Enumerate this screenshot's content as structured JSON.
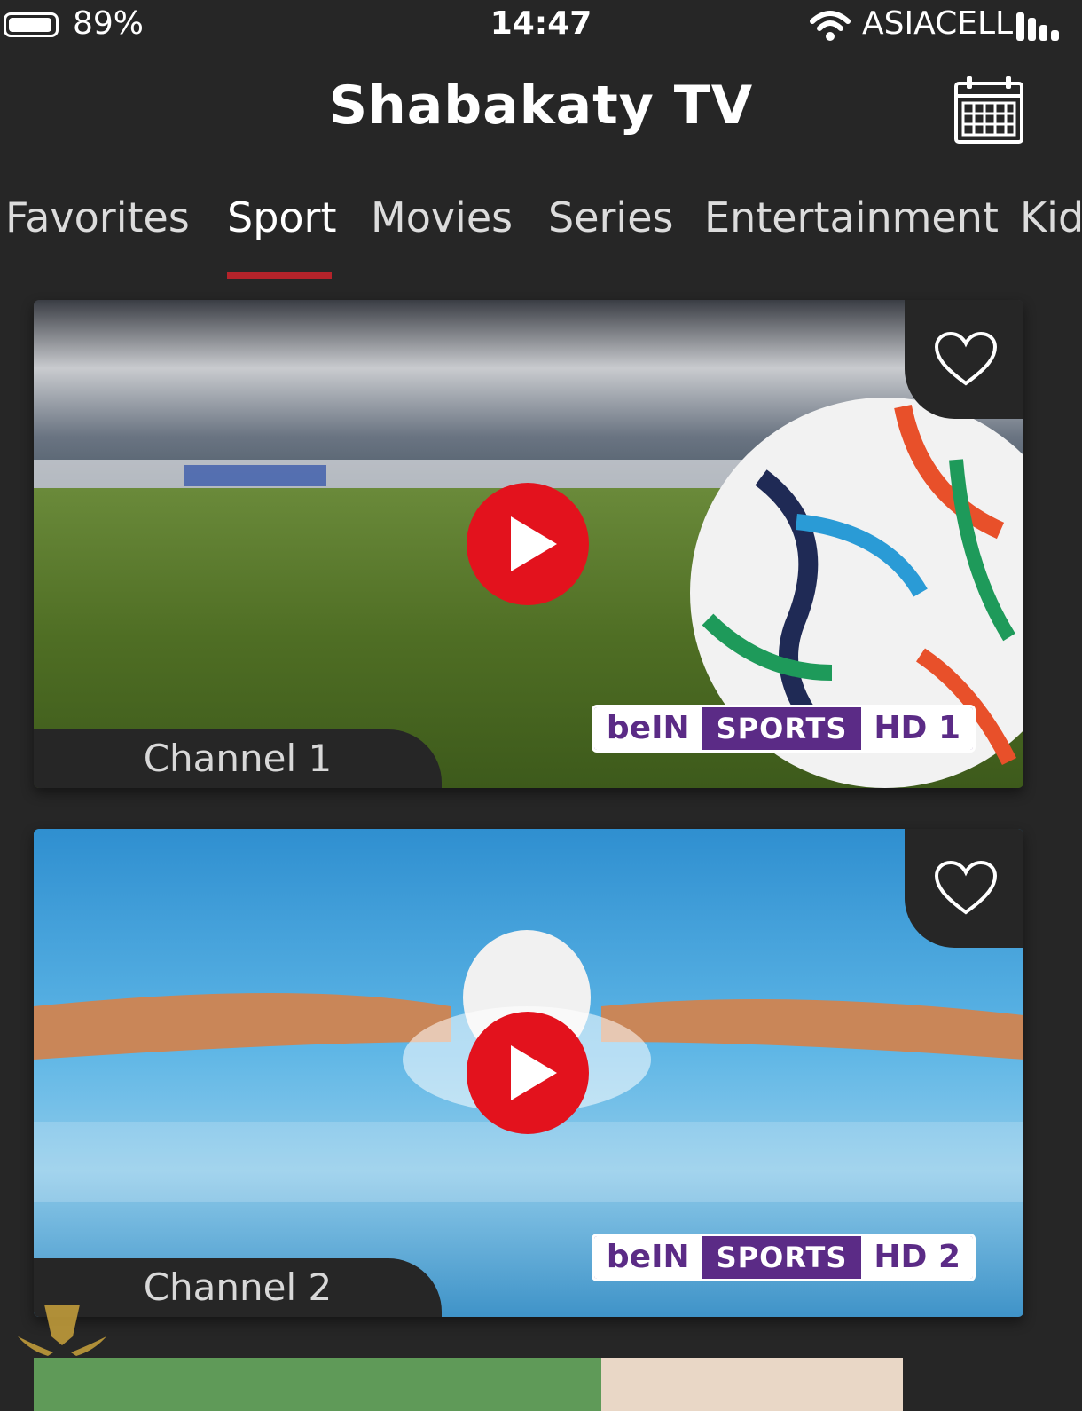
{
  "status_bar": {
    "battery_percent": "89%",
    "battery_level": 0.89,
    "time": "14:47",
    "carrier": "ASIACELL"
  },
  "header": {
    "title": "Shabakaty TV",
    "calendar_icon": "calendar-icon"
  },
  "tabs": [
    {
      "label": "Favorites",
      "active": false
    },
    {
      "label": "Sport",
      "active": true
    },
    {
      "label": "Movies",
      "active": false
    },
    {
      "label": "Series",
      "active": false
    },
    {
      "label": "Entertainment",
      "active": false
    },
    {
      "label": "Kid",
      "active": false
    }
  ],
  "channels": [
    {
      "name": "Channel 1",
      "logo_brand": "beIN",
      "logo_word": "SPORTS",
      "logo_hd": "HD 1",
      "thumbnail": "football on stadium grass",
      "favorite": false
    },
    {
      "name": "Channel 2",
      "logo_brand": "beIN",
      "logo_word": "SPORTS",
      "logo_hd": "HD 2",
      "thumbnail": "swimmer doing butterfly stroke",
      "favorite": false
    }
  ],
  "colors": {
    "background": "#262626",
    "accent": "#b4232a",
    "play": "#e3121d",
    "logo_purple": "#5b2b86"
  }
}
